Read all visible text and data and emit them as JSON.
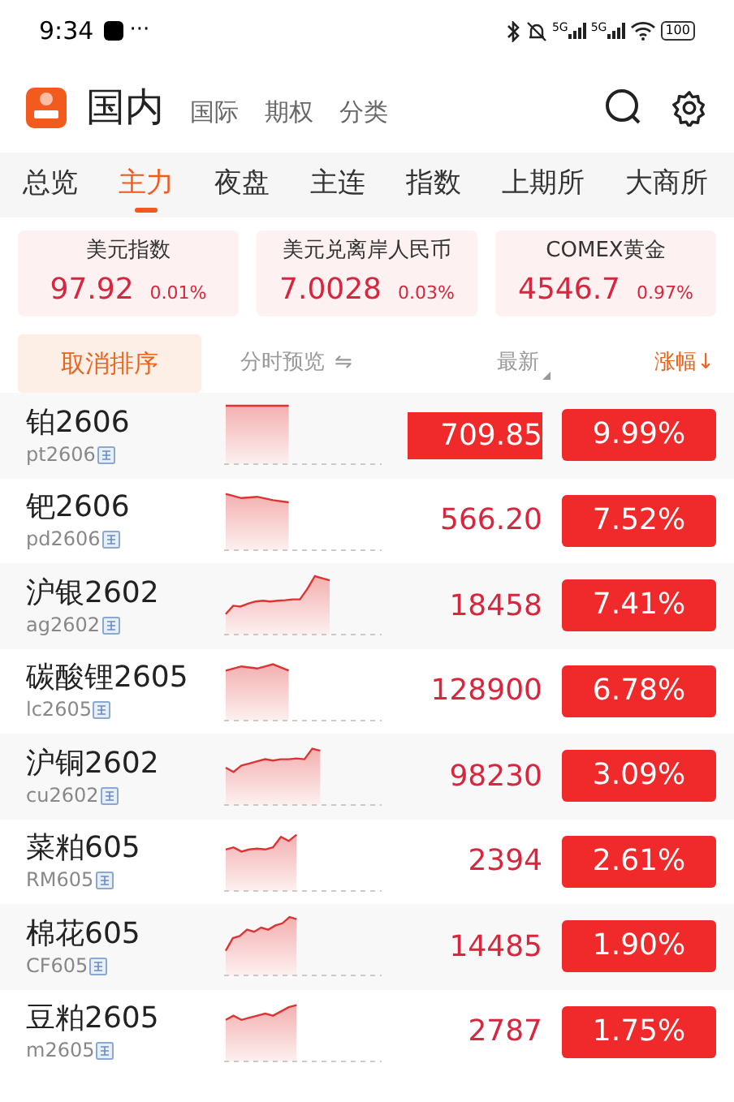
{
  "status_bar": {
    "time": "9:34",
    "more": "···",
    "signal_labels": [
      "5G",
      "5G"
    ],
    "battery": "100"
  },
  "header": {
    "title": "国内",
    "links": [
      "国际",
      "期权",
      "分类"
    ]
  },
  "tabs": [
    {
      "label": "总览",
      "selected": false
    },
    {
      "label": "主力",
      "selected": true
    },
    {
      "label": "夜盘",
      "selected": false
    },
    {
      "label": "主连",
      "selected": false
    },
    {
      "label": "指数",
      "selected": false
    },
    {
      "label": "上期所",
      "selected": false
    },
    {
      "label": "大商所",
      "selected": false
    }
  ],
  "indices": [
    {
      "name": "美元指数",
      "value": "97.92",
      "change": "0.01%"
    },
    {
      "name": "美元兑离岸人民币",
      "value": "7.0028",
      "change": "0.03%"
    },
    {
      "name": "COMEX黄金",
      "value": "4546.7",
      "change": "0.97%"
    }
  ],
  "sort_bar": {
    "cancel": "取消排序",
    "preview": "分时预览",
    "swap": "⇋",
    "latest": "最新",
    "change": "涨幅",
    "change_arrow": "↓"
  },
  "rows": [
    {
      "name": "铂2606",
      "code": "pt2606",
      "price": "709.85",
      "change": "9.99%",
      "flash": true
    },
    {
      "name": "钯2606",
      "code": "pd2606",
      "price": "566.20",
      "change": "7.52%",
      "flash": false
    },
    {
      "name": "沪银2602",
      "code": "ag2602",
      "price": "18458",
      "change": "7.41%",
      "flash": false
    },
    {
      "name": "碳酸锂2605",
      "code": "lc2605",
      "price": "128900",
      "change": "6.78%",
      "flash": false
    },
    {
      "name": "沪铜2602",
      "code": "cu2602",
      "price": "98230",
      "change": "3.09%",
      "flash": false
    },
    {
      "name": "菜粕605",
      "code": "RM605",
      "price": "2394",
      "change": "2.61%",
      "flash": false
    },
    {
      "name": "棉花605",
      "code": "CF605",
      "price": "14485",
      "change": "1.90%",
      "flash": false
    },
    {
      "name": "豆粕2605",
      "code": "m2605",
      "price": "2787",
      "change": "1.75%",
      "flash": false
    }
  ]
}
